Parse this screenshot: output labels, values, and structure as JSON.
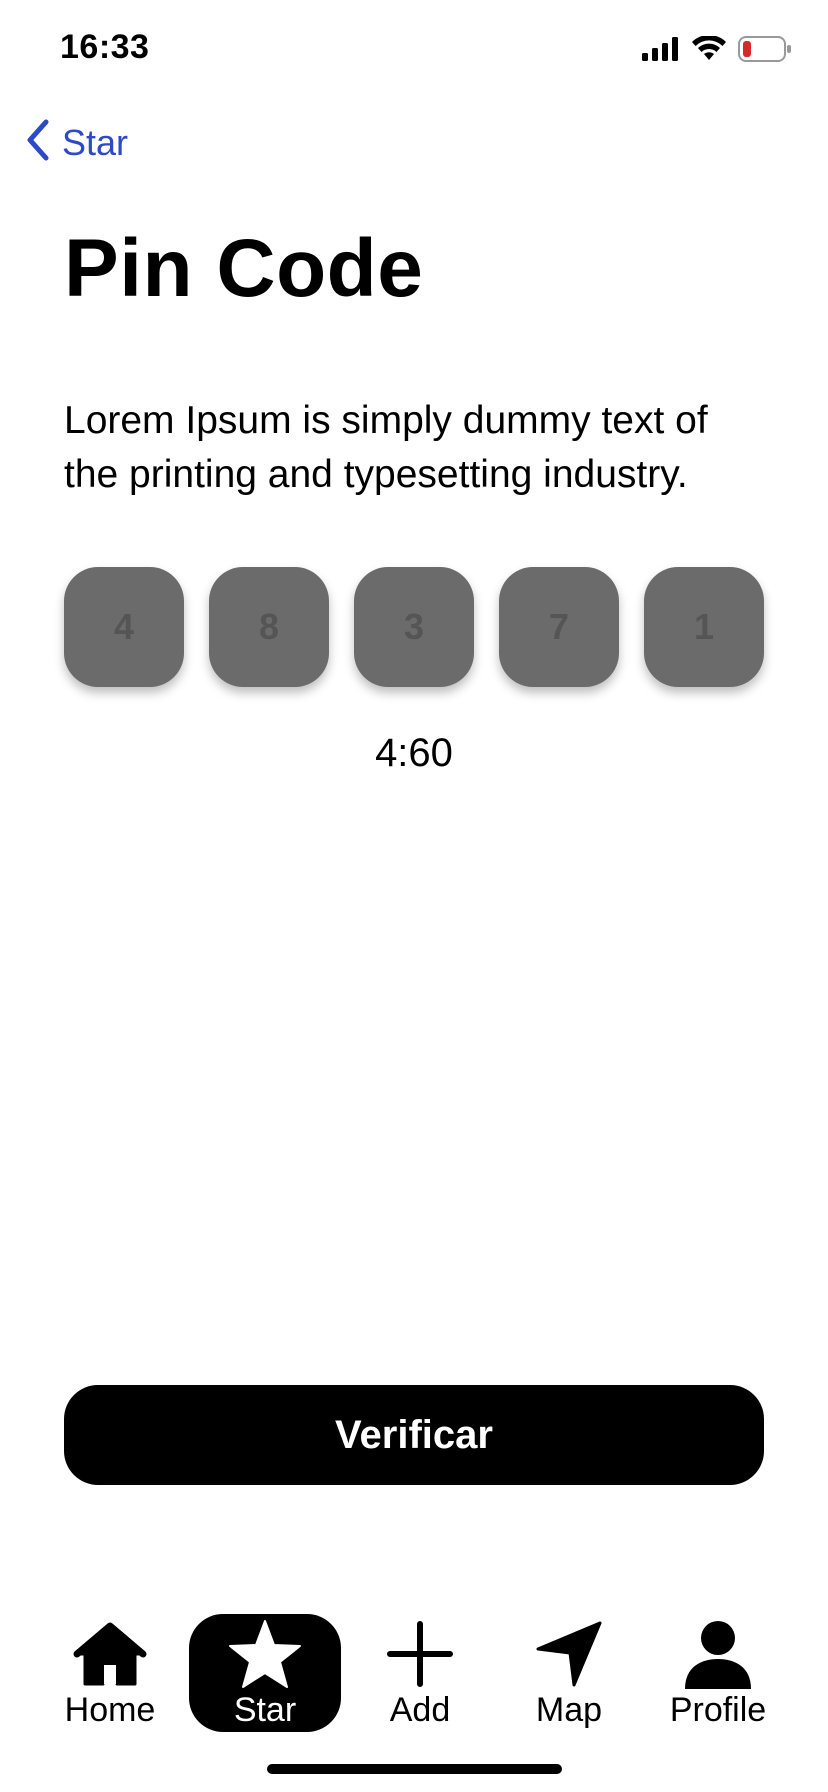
{
  "status_bar": {
    "time": "16:33"
  },
  "nav": {
    "back_label": "Star"
  },
  "page": {
    "title": "Pin Code",
    "description": "Lorem Ipsum is simply dummy text of the printing and typesetting industry."
  },
  "pin_code": {
    "digits": [
      "4",
      "8",
      "3",
      "7",
      "1"
    ]
  },
  "timer": "4:60",
  "verify_button": {
    "label": "Verificar"
  },
  "tab_bar": {
    "items": [
      {
        "label": "Home",
        "icon": "home-icon"
      },
      {
        "label": "Star",
        "icon": "star-icon",
        "active": true
      },
      {
        "label": "Add",
        "icon": "plus-icon"
      },
      {
        "label": "Map",
        "icon": "location-arrow-icon"
      },
      {
        "label": "Profile",
        "icon": "person-icon"
      }
    ]
  },
  "colors": {
    "accent": "#2c49c8",
    "pin_box": "#6b6b6b",
    "button": "#000000"
  }
}
